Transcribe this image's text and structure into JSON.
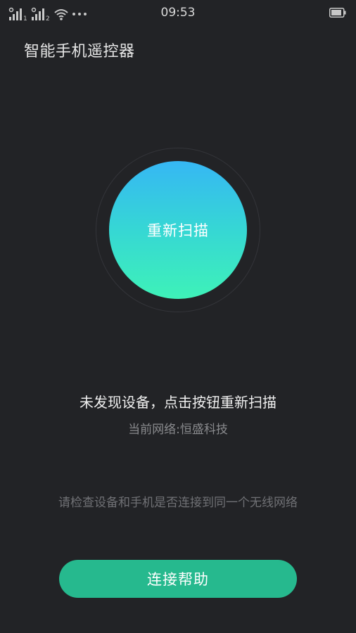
{
  "status_bar": {
    "time": "09:53",
    "sim1_label": "1",
    "sim2_label": "2",
    "icons": [
      "signal-icon",
      "signal-icon",
      "wifi-icon",
      "more-dots-icon",
      "battery-icon"
    ]
  },
  "header": {
    "title": "智能手机遥控器"
  },
  "scan": {
    "button_label": "重新扫描",
    "gradient_top": "#36b7f4",
    "gradient_bottom": "#3ef2b8"
  },
  "status": {
    "message": "未发现设备，点击按钮重新扫描",
    "network": "当前网络:恒盛科技"
  },
  "hint": {
    "text": "请检查设备和手机是否连接到同一个无线网络"
  },
  "help": {
    "button_label": "连接帮助",
    "color": "#26b98e"
  }
}
